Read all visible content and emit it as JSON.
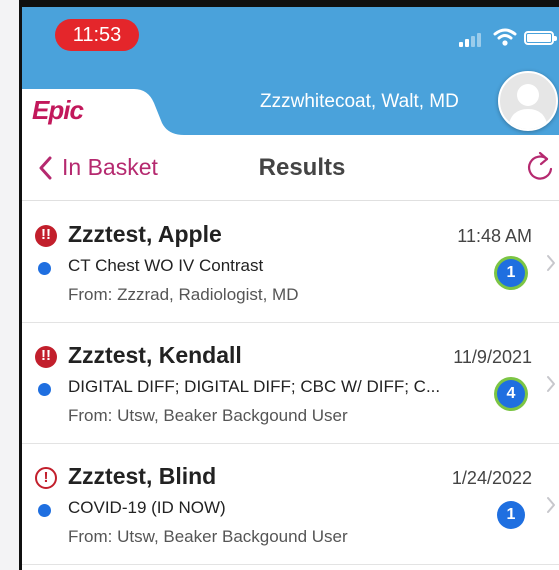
{
  "status_bar": {
    "time": "11:53"
  },
  "header": {
    "logo": "Epic",
    "user_name": "Zzzwhitecoat, Walt, MD"
  },
  "navbar": {
    "back_label": "In Basket",
    "title": "Results"
  },
  "messages": [
    {
      "priority": "high",
      "patient": "Zzztest, Apple",
      "date": "11:48 AM",
      "subject": "CT Chest WO IV Contrast",
      "from": "From: Zzzrad, Radiologist, MD",
      "count": "1",
      "count_highlight": true
    },
    {
      "priority": "high",
      "patient": "Zzztest, Kendall",
      "date": "11/9/2021",
      "subject": "DIGITAL DIFF; DIGITAL DIFF; CBC W/ DIFF; C...",
      "from": "From: Utsw, Beaker Backgound User",
      "count": "4",
      "count_highlight": true
    },
    {
      "priority": "normal",
      "patient": "Zzztest, Blind",
      "date": "1/24/2022",
      "subject": "COVID-19 (ID NOW)",
      "from": "From: Utsw, Beaker Backgound User",
      "count": "1",
      "count_highlight": false
    }
  ],
  "colors": {
    "header_blue": "#4aa2db",
    "epic_magenta": "#c2185b",
    "nav_accent": "#b5296f",
    "priority_red": "#c21f2c",
    "unread_blue": "#1f6fe0",
    "highlight_ring": "#7cc544"
  },
  "icons": {
    "priority_high": "exclamation-double-icon",
    "priority_normal": "exclamation-icon",
    "back": "chevron-left-icon",
    "refresh": "refresh-icon",
    "row_chevron": "chevron-right-icon"
  }
}
